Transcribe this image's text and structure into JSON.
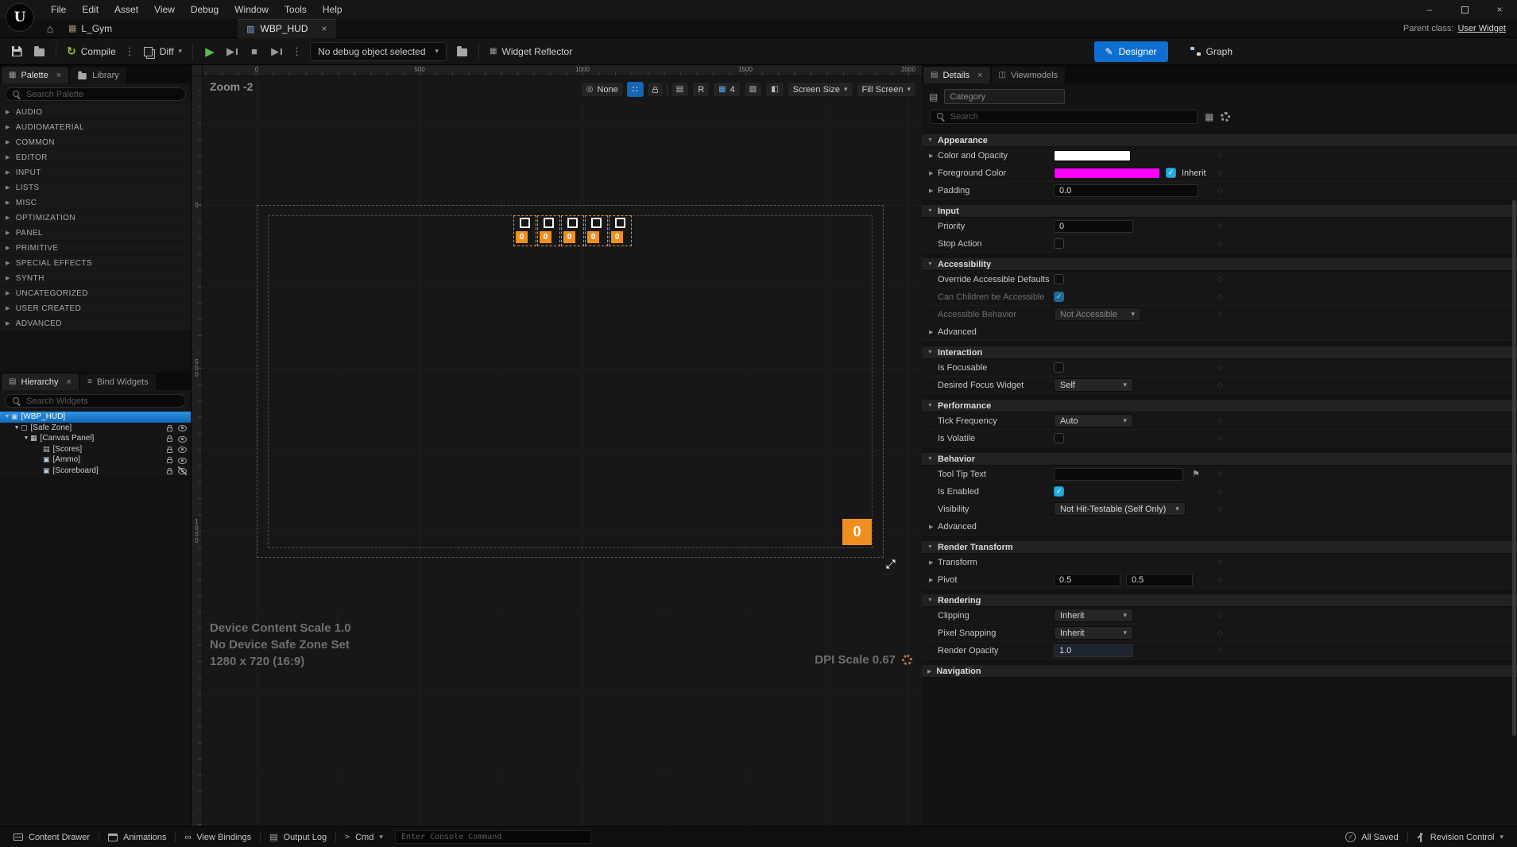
{
  "colors": {
    "accent_blue": "#0f6fd0",
    "checkbox_blue": "#29a9e0",
    "selection_orange": "#ef8f1f",
    "foreground_magenta": "#ff00ff",
    "color_opacity_swatch": "#ffffff"
  },
  "icons": {
    "logo": "U",
    "triangle_right": "▶",
    "triangle_down": "▼",
    "caret_down": "▾",
    "close": "×",
    "home": "⌂",
    "list": "▤",
    "grid": "▦",
    "image": "▨",
    "flip": "◧",
    "kebab": "⋮",
    "globe": "◎",
    "dots_grid": "∷",
    "check": "✓",
    "play": "▶",
    "stop": "■",
    "flag": "⚑",
    "diamond": "◇",
    "compile": "↻",
    "pen": "✎",
    "minimize": "–",
    "hamburger": "≡",
    "link": "∞",
    "prompt": ">",
    "widget": "▥",
    "widget_filled": "▣",
    "safe_zone": "▢",
    "viewmodels": "◫"
  },
  "menu": {
    "items": [
      "File",
      "Edit",
      "Asset",
      "View",
      "Debug",
      "Window",
      "Tools",
      "Help"
    ]
  },
  "tabs": {
    "level_crumb": "L_Gym",
    "doc_tab": "WBP_HUD",
    "parent_class_label": "Parent class:",
    "parent_class_value": "User Widget"
  },
  "toolbar": {
    "compile": "Compile",
    "diff": "Diff",
    "debug_dropdown": "No debug object selected",
    "widget_reflector": "Widget Reflector",
    "designer": "Designer",
    "graph": "Graph"
  },
  "palette": {
    "tab": "Palette",
    "library_tab": "Library",
    "search_placeholder": "Search Palette",
    "categories": [
      "AUDIO",
      "AUDIOMATERIAL",
      "COMMON",
      "EDITOR",
      "INPUT",
      "LISTS",
      "MISC",
      "OPTIMIZATION",
      "PANEL",
      "PRIMITIVE",
      "SPECIAL EFFECTS",
      "SYNTH",
      "UNCATEGORIZED",
      "USER CREATED",
      "ADVANCED"
    ]
  },
  "hierarchy": {
    "tab": "Hierarchy",
    "bind_widgets_tab": "Bind Widgets",
    "search_placeholder": "Search Widgets",
    "items": [
      {
        "label": "[WBP_HUD]"
      },
      {
        "label": "[Safe Zone]"
      },
      {
        "label": "[Canvas Panel]"
      },
      {
        "label": "[Scores]"
      },
      {
        "label": "[Ammo]"
      },
      {
        "label": "[Scoreboard]"
      }
    ]
  },
  "canvas": {
    "zoom_label": "Zoom -2",
    "ruler_h": [
      "0",
      "500",
      "1000",
      "1500",
      "2000"
    ],
    "ruler_v": [
      "0",
      "500",
      "1000"
    ],
    "overlay": {
      "none": "None",
      "r": "R",
      "grid_size": "4",
      "screen_size": "Screen Size",
      "fill_screen": "Fill Screen"
    },
    "ammo": [
      "0",
      "0",
      "0",
      "0",
      "0"
    ],
    "score": "0",
    "device_scale": "Device Content Scale 1.0",
    "safe_zone": "No Device Safe Zone Set",
    "resolution": "1280 x 720 (16:9)",
    "dpi": "DPI Scale 0.67"
  },
  "details": {
    "tab": "Details",
    "viewmodels_tab": "Viewmodels",
    "category_placeholder": "Category",
    "search_placeholder": "Search",
    "appearance": {
      "title": "Appearance",
      "color_and_opacity": "Color and Opacity",
      "foreground_color": "Foreground Color",
      "inherit": "Inherit",
      "padding": "Padding",
      "padding_value": "0.0"
    },
    "input": {
      "title": "Input",
      "priority": "Priority",
      "priority_value": "0",
      "stop_action": "Stop Action"
    },
    "accessibility": {
      "title": "Accessibility",
      "override_defaults": "Override Accessible Defaults",
      "can_children": "Can Children be Accessible",
      "behavior": "Accessible Behavior",
      "behavior_value": "Not Accessible",
      "advanced": "Advanced"
    },
    "interaction": {
      "title": "Interaction",
      "is_focusable": "Is Focusable",
      "desired_focus": "Desired Focus Widget",
      "desired_focus_value": "Self"
    },
    "performance": {
      "title": "Performance",
      "tick_frequency": "Tick Frequency",
      "tick_frequency_value": "Auto",
      "is_volatile": "Is Volatile"
    },
    "behavior": {
      "title": "Behavior",
      "tooltip": "Tool Tip Text",
      "tooltip_value": "",
      "is_enabled": "Is Enabled",
      "visibility": "Visibility",
      "visibility_value": "Not Hit-Testable (Self Only)",
      "advanced": "Advanced"
    },
    "render_transform": {
      "title": "Render Transform",
      "transform": "Transform",
      "pivot": "Pivot",
      "pivot_x": "0.5",
      "pivot_y": "0.5"
    },
    "rendering": {
      "title": "Rendering",
      "clipping": "Clipping",
      "clipping_value": "Inherit",
      "pixel_snapping": "Pixel Snapping",
      "pixel_snapping_value": "Inherit",
      "render_opacity": "Render Opacity",
      "render_opacity_value": "1.0"
    },
    "navigation": {
      "title": "Navigation"
    }
  },
  "status_bar": {
    "content_drawer": "Content Drawer",
    "animations": "Animations",
    "view_bindings": "View Bindings",
    "output_log": "Output Log",
    "cmd": "Cmd",
    "console_placeholder": "Enter Console Command",
    "all_saved": "All Saved",
    "revision_control": "Revision Control"
  }
}
